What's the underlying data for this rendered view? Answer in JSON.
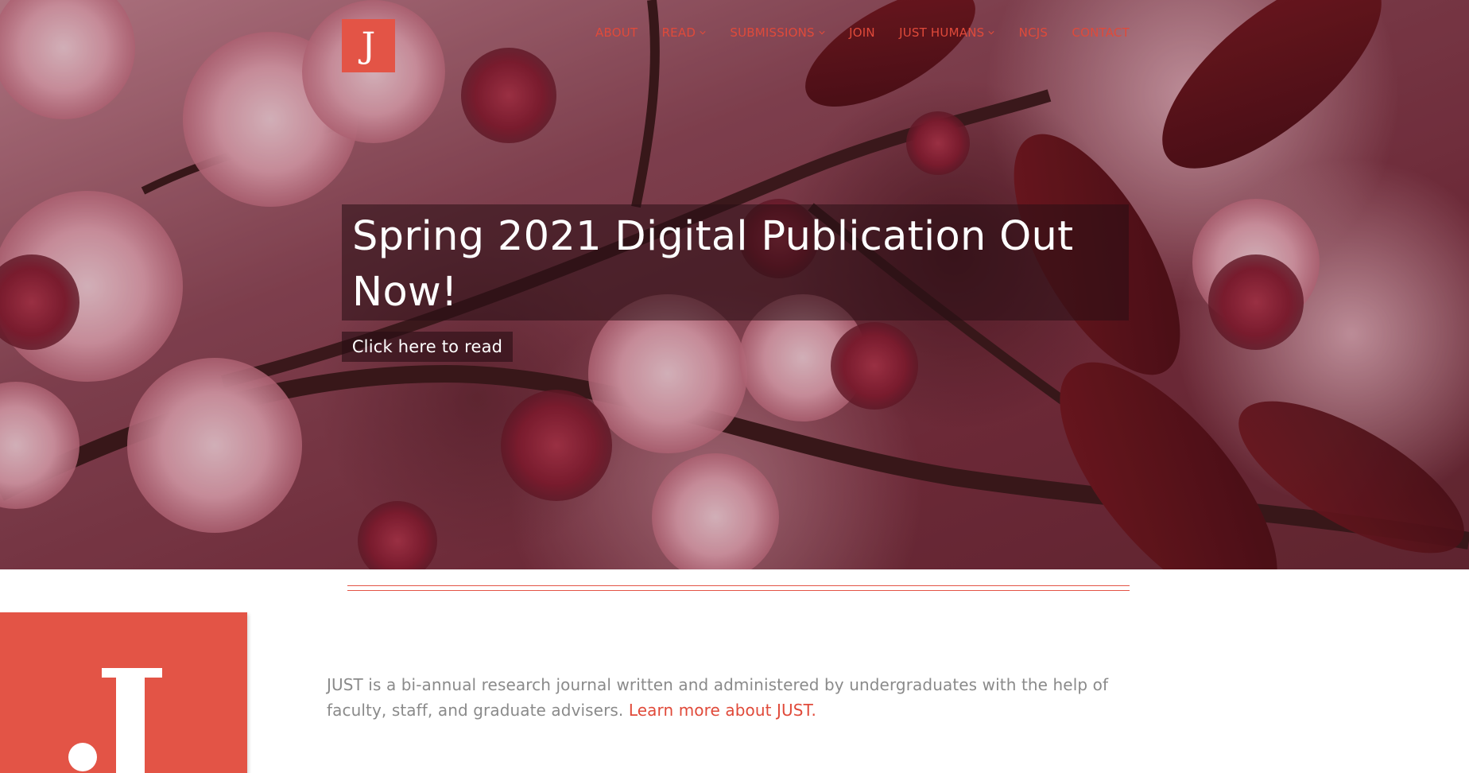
{
  "site": {
    "logo_letter": "J",
    "brand_color": "#e35446",
    "nav_color": "#e04a3a"
  },
  "nav": {
    "items": [
      {
        "label": "ABOUT",
        "has_dropdown": false
      },
      {
        "label": "READ",
        "has_dropdown": true
      },
      {
        "label": "SUBMISSIONS",
        "has_dropdown": true
      },
      {
        "label": "JOIN",
        "has_dropdown": false
      },
      {
        "label": "JUST HUMANS",
        "has_dropdown": true
      },
      {
        "label": "NCJS",
        "has_dropdown": false
      },
      {
        "label": "CONTACT",
        "has_dropdown": false
      }
    ]
  },
  "hero": {
    "title": "Spring 2021 Digital Publication Out Now!",
    "cta_label": "Click here to read",
    "background": "pink cherry blossoms on branches"
  },
  "intro": {
    "text": "JUST is a bi-annual research journal written and administered by undergraduates with the help of faculty, staff, and graduate advisers.",
    "link_label": "Learn more about JUST."
  },
  "big_logo": {
    "letter": "J"
  }
}
